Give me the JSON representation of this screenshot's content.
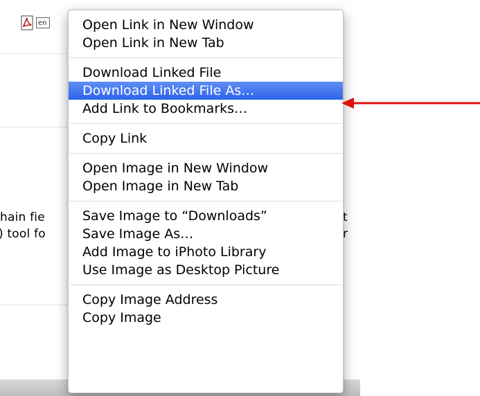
{
  "background": {
    "icons": [
      "pdf-icon",
      "document-icon"
    ],
    "doc_icon_text": "en",
    "text_fragments": [
      "hain fie",
      ") tool fo",
      "t",
      "r"
    ]
  },
  "context_menu": {
    "groups": [
      [
        "Open Link in New Window",
        "Open Link in New Tab"
      ],
      [
        "Download Linked File",
        "Download Linked File As…",
        "Add Link to Bookmarks…"
      ],
      [
        "Copy Link"
      ],
      [
        "Open Image in New Window",
        "Open Image in New Tab"
      ],
      [
        "Save Image to “Downloads”",
        "Save Image As…",
        "Add Image to iPhoto Library",
        "Use Image as Desktop Picture"
      ],
      [
        "Copy Image Address",
        "Copy Image"
      ]
    ],
    "highlighted_item": "Download Linked File As…",
    "highlight_color": "#3b6ff0"
  },
  "annotation": {
    "arrow_color": "#e01010",
    "points_to": "Download Linked File As…"
  }
}
